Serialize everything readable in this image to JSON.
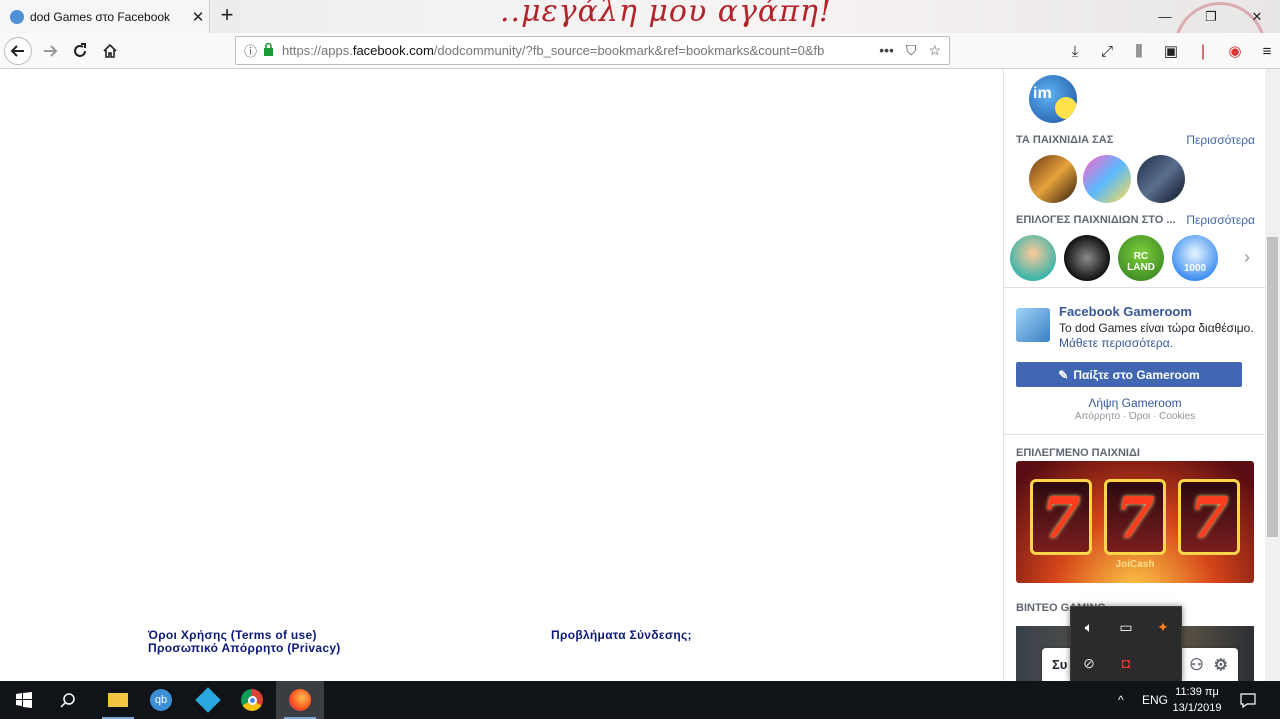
{
  "browser": {
    "tab_title": "dod Games στο Facebook",
    "tab_close": "✕",
    "new_tab": "+",
    "theme_text": "..μεγάλη μου αγάπη!",
    "window_buttons": [
      "—",
      "❐",
      "✕"
    ]
  },
  "nav": {
    "url_prefix": "https://apps.",
    "url_domain": "facebook.com",
    "url_rest": "/dodcommunity/?fb_source=bookmark&ref=bookmarks&count=0&fb",
    "page_actions": [
      "•••",
      "⛉",
      "☆"
    ]
  },
  "page": {
    "footer_left": [
      "Όροι Χρήσης (Terms of use)",
      "Προσωπικό Απόρρητο (Privacy)"
    ],
    "footer_right": "Προβλήματα Σύνδεσης;"
  },
  "sidebar": {
    "top_avatar_text": "im",
    "your_games_title": "ΤΑ ΠΑΙΧΝΙΔΙΑ ΣΑΣ",
    "your_games_more": "Περισσότερα",
    "picks_title": "ΕΠΙΛΟΓΕΣ ΠΑΙΧΝΙΔΙΩΝ ΣΤΟ ...",
    "picks_more": "Περισσότερα",
    "pick_labels": [
      "RC LAND",
      "1000"
    ],
    "gameroom": {
      "title": "Facebook Gameroom",
      "desc": "Το dod Games είναι τώρα διαθέσιμο.",
      "learn_more": "Μάθετε περισσότερα.",
      "play_button": "Παίξτε στο Gameroom",
      "download": "Λήψη Gameroom",
      "fine_print": "Απόρρητο · Όροι · Cookies"
    },
    "featured_title": "ΕΠΙΛΕΓΜΕΝΟ ΠΑΙΧΝΙΔΙ",
    "slot_symbol": "7",
    "slot_brand": "JoiCash",
    "video_title": "ΒΙΝΤΕΟ GAMING",
    "chat_label": "Συ"
  },
  "taskbar": {
    "lang": "ENG",
    "time": "11:39 πμ",
    "date": "13/1/2019"
  }
}
